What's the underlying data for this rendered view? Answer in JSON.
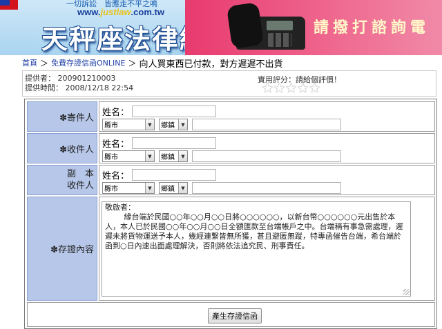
{
  "banner": {
    "slogan": "一切訴訟　皆應走不平之鳴",
    "url_prefix": "www.",
    "url_highlight": "justlaw",
    "url_suffix": ".com.tw",
    "brand": "天秤座法律網",
    "cta": "請撥打諮詢電"
  },
  "breadcrumb": {
    "home": "首頁",
    "section": "免費存證信函ONLINE",
    "separator": "＞",
    "current": "向人買東西已付款，對方遲遲不出貨"
  },
  "info": {
    "provider_label": "提供者：",
    "provider_id": "200901210003",
    "time_label": "提供時間：",
    "time_value": "2008/12/18 22:54",
    "rating_label": "實用評分：請給個評價！",
    "rating_stars": 5
  },
  "form": {
    "sender": {
      "label": "✽寄件人",
      "name_label": "姓名：",
      "county": "縣市",
      "town": "鄉鎮"
    },
    "recipient": {
      "label": "✽收件人",
      "name_label": "姓名：",
      "county": "縣市",
      "town": "鄉鎮"
    },
    "cc": {
      "label_line1": "副　本",
      "label_line2": "收件人",
      "name_label": "姓名：",
      "county": "縣市",
      "town": "鄉鎮"
    },
    "content": {
      "label": "✽存證內容",
      "greeting": "敬啟者：",
      "body": "緣台端於民國○○年○○月○○日將○○○○○○，以新台幣○○○○○○元出售於本人，本人已於民國○○年○○月○○日全額匯款至台端帳戶之中。台端稱有事急需處理，遲遲未將貨物運送予本人，幾經連繫皆無所獲，甚且避匿無蹤，特專函催告台端，希台端於函到○日內速出面處理解決，否則將依法追究民、刑事責任。"
    },
    "submit_label": "產生存證信函"
  }
}
